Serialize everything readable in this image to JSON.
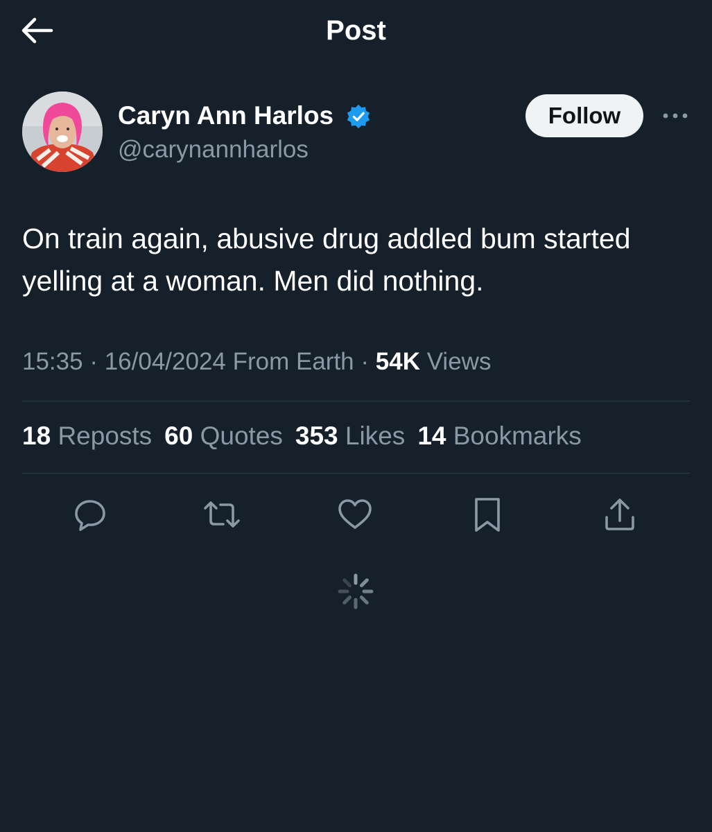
{
  "header": {
    "title": "Post",
    "back_icon": "arrow-left-icon"
  },
  "author": {
    "name": "Caryn Ann Harlos",
    "handle": "@carynannharlos",
    "verified": true,
    "verified_color": "#1d9bf0",
    "follow_label": "Follow",
    "more_icon": "more-horizontal-icon"
  },
  "post": {
    "text": "On train again, abusive drug addled bum started yelling at a woman.  Men did nothing.",
    "time": "15:35",
    "date": "16/04/2024",
    "source": "From Earth",
    "views_count": "54K",
    "views_label": "Views"
  },
  "stats": [
    {
      "count": "18",
      "label": "Reposts"
    },
    {
      "count": "60",
      "label": "Quotes"
    },
    {
      "count": "353",
      "label": "Likes"
    },
    {
      "count": "14",
      "label": "Bookmarks"
    }
  ],
  "actions": [
    "reply-icon",
    "repost-icon",
    "like-icon",
    "bookmark-icon",
    "share-icon"
  ],
  "loading_icon": "loading-spinner-icon",
  "colors": {
    "background": "#16202b",
    "text_primary": "#ffffff",
    "text_secondary": "#8b98a5",
    "divider": "#2f3b47",
    "follow_button_bg": "#eff3f4"
  }
}
